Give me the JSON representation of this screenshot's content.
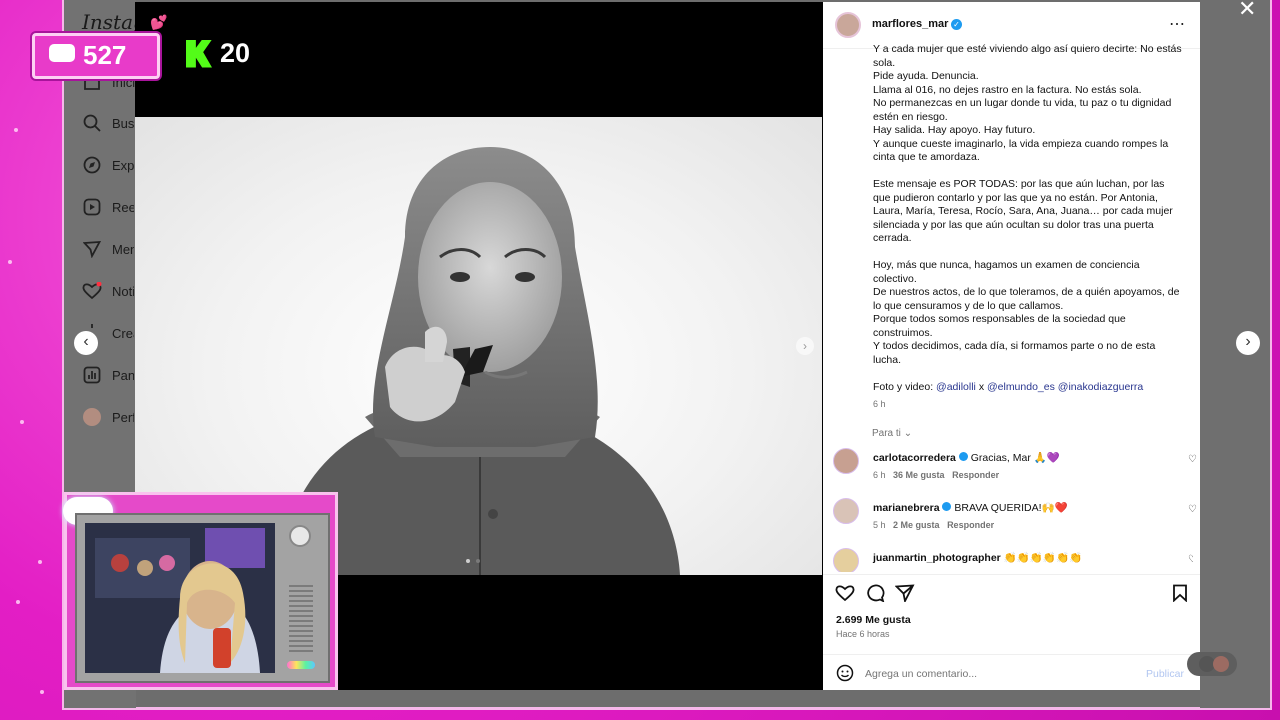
{
  "overlay": {
    "chat_count": "527",
    "k_count": "20"
  },
  "sidebar": {
    "logo": "Instagram",
    "items": [
      {
        "label": "Inicio",
        "icon": "home-icon"
      },
      {
        "label": "Busqueda",
        "icon": "search-icon"
      },
      {
        "label": "Explorar",
        "icon": "compass-icon"
      },
      {
        "label": "Reels",
        "icon": "reels-icon"
      },
      {
        "label": "Mensajes",
        "icon": "messages-icon"
      },
      {
        "label": "Notificaciones",
        "icon": "heart-icon"
      },
      {
        "label": "Crear",
        "icon": "plus-icon"
      },
      {
        "label": "Panel",
        "icon": "dashboard-icon"
      },
      {
        "label": "Perfil",
        "icon": "profile-icon"
      }
    ]
  },
  "post": {
    "username": "marflores_mar",
    "caption_lines": [
      "Y a cada mujer que esté viviendo algo así quiero decirte: No estás sola.",
      "Pide ayuda. Denuncia.",
      "Llama al 016, no dejes rastro en la factura. No estás sola.",
      "No permanezcas en un lugar donde tu vida, tu paz o tu dignidad estén en riesgo.",
      "Hay salida. Hay apoyo. Hay futuro.",
      "Y aunque cueste imaginarlo, la vida empieza cuando rompes la cinta que te amordaza.",
      "",
      "Este mensaje es POR TODAS: por las que aún luchan, por las que pudieron contarlo y por las que ya no están. Por Antonia, Laura, María, Teresa, Rocío, Sara, Ana, Juana… por cada mujer silenciada y por las que aún ocultan su dolor tras una puerta cerrada.",
      "",
      "Hoy, más que nunca, hagamos un examen de conciencia colectivo.",
      "De nuestros actos, de lo que toleramos, de a quién apoyamos, de lo que censuramos y de lo que callamos.",
      "Porque todos somos responsables de la sociedad que construimos.",
      "Y todos decidimos, cada día, si formamos parte o no de esta lucha.",
      ""
    ],
    "credits_prefix": "Foto y video:",
    "credit_1": "@adilolli",
    "credit_x": "x",
    "credit_2": "@elmundo_es",
    "credit_3": "@inakodiazguerra",
    "time": "6 h",
    "para_ti": "Para ti",
    "comments": [
      {
        "user": "carlotacorredera",
        "text": "Gracias, Mar 🙏💜",
        "time": "6 h",
        "likes": "36 Me gusta",
        "reply": "Responder"
      },
      {
        "user": "marianebrera",
        "text": "BRAVA QUERIDA!🙌❤️",
        "time": "5 h",
        "likes": "2 Me gusta",
        "reply": "Responder"
      },
      {
        "user": "juanmartin_photographer",
        "text": "👏👏👏👏👏👏",
        "time": "",
        "likes": "",
        "reply": ""
      }
    ],
    "likes": "2.699 Me gusta",
    "posted": "Hace 6 horas",
    "comment_placeholder": "Agrega un comentario...",
    "publish": "Publicar"
  },
  "colors": {
    "magenta": "#e21fc4",
    "link": "#29368f",
    "publish": "#b2c6f0"
  }
}
